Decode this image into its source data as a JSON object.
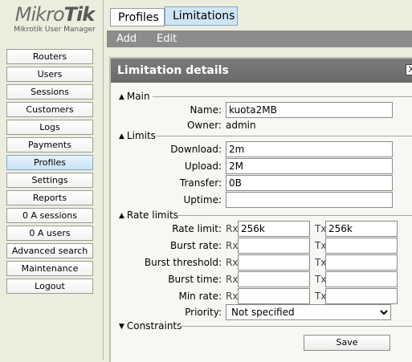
{
  "logo": {
    "brand_light": "Mikro",
    "brand_bold": "Tik",
    "subtitle": "Mikrotik User Manager"
  },
  "sidebar": {
    "items": [
      {
        "label": "Routers"
      },
      {
        "label": "Users"
      },
      {
        "label": "Sessions"
      },
      {
        "label": "Customers"
      },
      {
        "label": "Logs"
      },
      {
        "label": "Payments"
      },
      {
        "label": "Profiles",
        "active": true
      },
      {
        "label": "Settings"
      },
      {
        "label": "Reports"
      },
      {
        "label": "0 A sessions"
      },
      {
        "label": "0 A users"
      },
      {
        "label": "Advanced search"
      },
      {
        "label": "Maintenance"
      },
      {
        "label": "Logout"
      }
    ]
  },
  "tabs": [
    {
      "label": "Profiles"
    },
    {
      "label": "Limitations",
      "active": true
    }
  ],
  "actions": {
    "add": "Add",
    "edit": "Edit"
  },
  "panel": {
    "title": "Limitation details",
    "close": "X",
    "main": {
      "heading": "Main",
      "name_label": "Name:",
      "name_value": "kuota2MB",
      "owner_label": "Owner:",
      "owner_value": "admin"
    },
    "limits": {
      "heading": "Limits",
      "download_label": "Download:",
      "download_value": "2m",
      "upload_label": "Upload:",
      "upload_value": "2M",
      "transfer_label": "Transfer:",
      "transfer_value": "0B",
      "uptime_label": "Uptime:",
      "uptime_value": ""
    },
    "rate_limits": {
      "heading": "Rate limits",
      "rx": "Rx",
      "tx": "Tx",
      "rate_limit_label": "Rate limit:",
      "rate_limit_rx": "256k",
      "rate_limit_tx": "256k",
      "burst_rate_label": "Burst rate:",
      "burst_threshold_label": "Burst threshold:",
      "burst_time_label": "Burst time:",
      "min_rate_label": "Min rate:",
      "priority_label": "Priority:",
      "priority_value": "Not specified"
    },
    "constraints": {
      "heading": "Constraints"
    },
    "save": "Save"
  },
  "colors": {
    "background": "#ededde",
    "action_bar": "#8c8c8c",
    "panel_title": "#6f6f6f",
    "active_tab": "#cfe5f6"
  }
}
